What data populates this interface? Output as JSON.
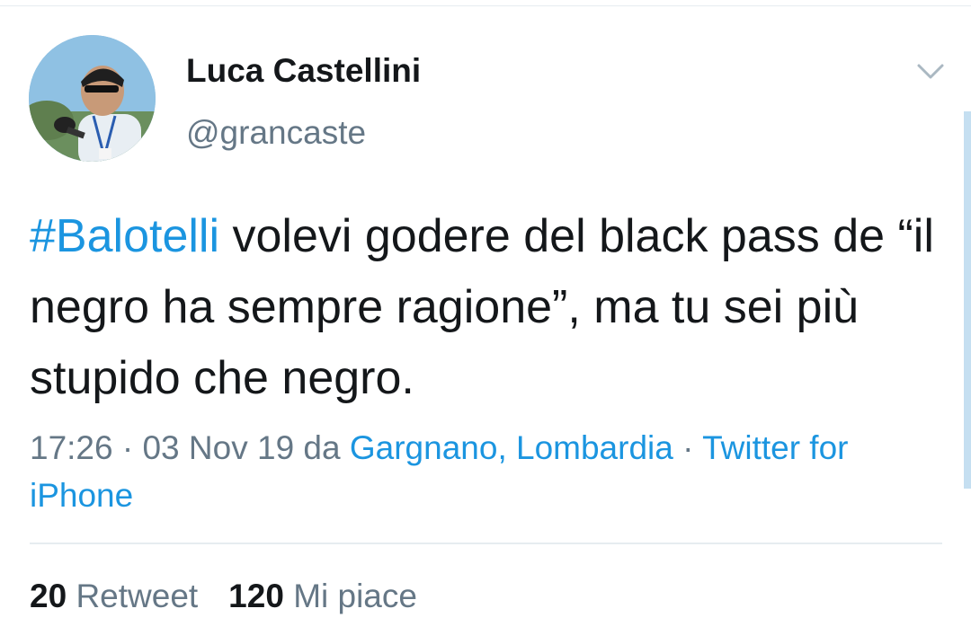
{
  "tweet": {
    "author": {
      "name": "Luca Castellini",
      "handle": "@grancaste"
    },
    "text": {
      "hashtag": "#Balotelli",
      "body": " volevi godere del black pass de “il negro ha sempre ragione”, ma tu sei più stupido che negro."
    },
    "meta": {
      "time": "17:26",
      "separator1": " · ",
      "date": "03 Nov 19",
      "location_prefix": " da ",
      "location": "Gargnano, Lombardia",
      "separator2": " · ",
      "source": "Twitter for iPhone"
    },
    "stats": {
      "retweets_count": "20",
      "retweets_label": "Retweet",
      "likes_count": "120",
      "likes_label": "Mi piace"
    }
  },
  "icons": {
    "menu": "chevron-down-icon",
    "avatar": "avatar"
  },
  "colors": {
    "link": "#1b95e0",
    "secondary_text": "#657786",
    "primary_text": "#14171a",
    "divider": "#e6ecf0"
  }
}
